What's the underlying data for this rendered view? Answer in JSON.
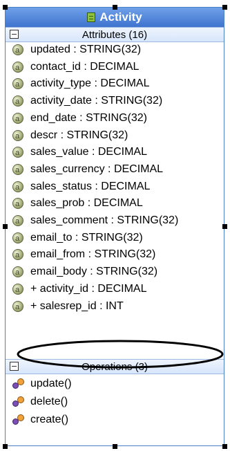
{
  "class": {
    "name": "Activity",
    "attributes_header": "Attributes (16)",
    "attributes": [
      "updated : STRING(32)",
      "contact_id : DECIMAL",
      "activity_type : DECIMAL",
      "activity_date : STRING(32)",
      "end_date : STRING(32)",
      "descr : STRING(32)",
      "sales_value : DECIMAL",
      "sales_currency : DECIMAL",
      "sales_status : DECIMAL",
      "sales_prob : DECIMAL",
      "sales_comment : STRING(32)",
      "email_to : STRING(32)",
      "email_from : STRING(32)",
      "email_body : STRING(32)",
      "+ activity_id : DECIMAL",
      "+ salesrep_id : INT"
    ],
    "operations_header": "Operations (3)",
    "operations": [
      "update()",
      "delete()",
      "create()"
    ]
  },
  "icons": {
    "class": "class-icon",
    "attribute": "attribute-icon",
    "operation": "operation-icon",
    "collapse": "collapse-minus-icon"
  },
  "colors": {
    "header": "#3f74cf",
    "border": "#4a7fc7",
    "section": "#d7e6fb",
    "highlight": "#000000"
  }
}
